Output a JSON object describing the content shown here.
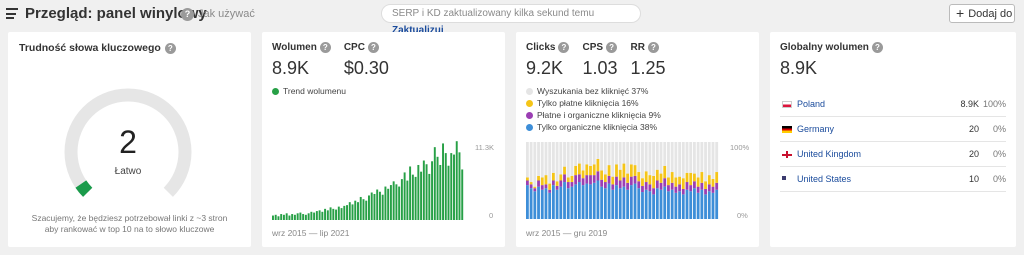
{
  "header": {
    "title": "Przegląd: panel winylowy",
    "how_to": "Jak używać",
    "update_text": "SERP i KD zaktualizowany kilka sekund temu",
    "update_link": "Zaktualizuj",
    "add_button": "Dodaj do"
  },
  "kd": {
    "label": "Trudność słowa kluczowego",
    "value": "2",
    "rating": "Łatwo",
    "description": "Szacujemy, że będziesz potrzebował linki z ~3 stron aby rankować w top 10 na to słowo kluczowe",
    "gauge_fraction": 0.02,
    "colors": {
      "track": "#e6e6e6",
      "fill": "#1a9b4b"
    }
  },
  "volume_card": {
    "volume_label": "Wolumen",
    "volume_value": "8.9K",
    "cpc_label": "CPC",
    "cpc_value": "$0.30",
    "legend": "Trend wolumenu",
    "y_max_label": "11.3K",
    "y_min_label": "0",
    "date_range": "wrz 2015 — lip 2021",
    "color": "#27a046"
  },
  "clicks_card": {
    "clicks_label": "Clicks",
    "clicks_value": "9.2K",
    "cps_label": "CPS",
    "cps_value": "1.03",
    "rr_label": "RR",
    "rr_value": "1.25",
    "legend": [
      {
        "label": "Wyszukania bez kliknięć 37%",
        "color": "#e5e5e5"
      },
      {
        "label": "Tylko płatne kliknięcia 16%",
        "color": "#f5c518"
      },
      {
        "label": "Płatne i organiczne kliknięcia 9%",
        "color": "#9b3fb3"
      },
      {
        "label": "Tylko organiczne kliknięcia 38%",
        "color": "#3d8ed8"
      }
    ],
    "y_max_label": "100%",
    "y_min_label": "0%",
    "date_range": "wrz 2015 — gru 2019"
  },
  "global_card": {
    "label": "Globalny wolumen",
    "value": "8.9K",
    "countries": [
      {
        "name": "Poland",
        "volume": "8.9K",
        "percent": "100%",
        "flag": "flag-pl"
      },
      {
        "name": "Germany",
        "volume": "20",
        "percent": "0%",
        "flag": "flag-de"
      },
      {
        "name": "United Kingdom",
        "volume": "20",
        "percent": "0%",
        "flag": "flag-uk"
      },
      {
        "name": "United States",
        "volume": "10",
        "percent": "0%",
        "flag": "flag-us"
      }
    ]
  },
  "chart_data": [
    {
      "type": "bar",
      "legend": "Trend wolumenu",
      "ylim": [
        0,
        11300
      ],
      "x_range": [
        "wrz 2015",
        "lip 2021"
      ],
      "values": [
        600,
        700,
        500,
        800,
        700,
        900,
        600,
        800,
        700,
        900,
        1000,
        800,
        700,
        900,
        1100,
        1000,
        1200,
        1300,
        1100,
        1500,
        1300,
        1700,
        1500,
        1400,
        1800,
        1600,
        1900,
        2000,
        2400,
        2100,
        2600,
        2400,
        3100,
        2800,
        2600,
        3300,
        3700,
        3500,
        4100,
        3800,
        3400,
        4500,
        4200,
        4700,
        5200,
        4800,
        4500,
        5500,
        6400,
        5300,
        7200,
        6100,
        5800,
        7400,
        6500,
        8000,
        7500,
        6200,
        7900,
        9800,
        8500,
        7400,
        10300,
        9000,
        7300,
        9000,
        8800,
        10600,
        9100,
        6800
      ]
    },
    {
      "type": "bar",
      "stacked": true,
      "ylim": [
        0,
        100
      ],
      "x_range": [
        "wrz 2015",
        "gru 2019"
      ],
      "series": [
        {
          "name": "Tylko organiczne kliknięcia",
          "values": [
            44,
            40,
            36,
            42,
            38,
            40,
            34,
            44,
            38,
            42,
            48,
            40,
            42,
            45,
            48,
            44,
            46,
            45,
            47,
            50,
            42,
            40,
            46,
            38,
            44,
            40,
            42,
            38,
            44,
            46,
            40,
            35,
            38,
            36,
            32,
            40,
            38,
            42,
            36,
            38,
            34,
            36,
            32,
            38,
            36,
            40,
            34,
            38,
            32,
            36,
            34,
            38
          ]
        },
        {
          "name": "Płatne i organiczne kliknięcia",
          "values": [
            6,
            5,
            4,
            8,
            6,
            5,
            4,
            6,
            5,
            8,
            10,
            8,
            6,
            12,
            10,
            9,
            11,
            12,
            10,
            12,
            9,
            8,
            10,
            7,
            11,
            10,
            12,
            9,
            11,
            10,
            9,
            8,
            10,
            9,
            8,
            10,
            9,
            11,
            8,
            9,
            8,
            9,
            7,
            10,
            8,
            9,
            8,
            9,
            7,
            9,
            8,
            9
          ]
        },
        {
          "name": "Tylko płatne kliknięcia",
          "values": [
            4,
            3,
            2,
            6,
            10,
            12,
            8,
            10,
            6,
            8,
            10,
            6,
            8,
            12,
            14,
            10,
            14,
            12,
            14,
            16,
            12,
            10,
            14,
            10,
            16,
            14,
            18,
            12,
            16,
            14,
            12,
            10,
            14,
            12,
            16,
            14,
            12,
            16,
            10,
            14,
            12,
            10,
            14,
            12,
            16,
            10,
            12,
            14,
            10,
            12,
            10,
            14
          ]
        },
        {
          "name": "Wyszukania bez kliknięć",
          "values": [
            46,
            52,
            58,
            44,
            46,
            43,
            54,
            40,
            51,
            42,
            32,
            46,
            44,
            31,
            28,
            37,
            29,
            31,
            29,
            22,
            37,
            42,
            30,
            45,
            29,
            36,
            28,
            41,
            29,
            30,
            39,
            47,
            38,
            43,
            44,
            36,
            41,
            31,
            46,
            39,
            46,
            45,
            47,
            40,
            40,
            41,
            46,
            39,
            51,
            43,
            48,
            39
          ]
        }
      ]
    }
  ]
}
